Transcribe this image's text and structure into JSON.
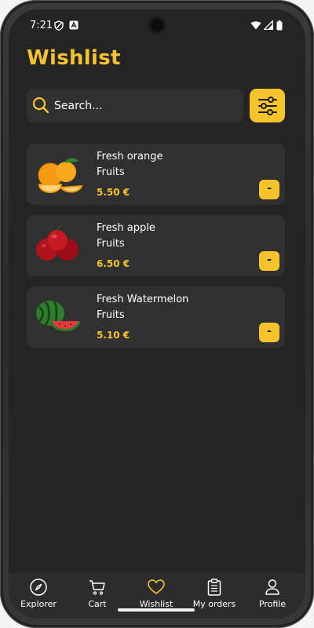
{
  "status_bar": {
    "time": "7:21"
  },
  "page": {
    "title": "Wishlist"
  },
  "search": {
    "placeholder": "Search..."
  },
  "wishlist": [
    {
      "name": "Fresh orange",
      "category": "Fruits",
      "price": "5.50 €",
      "remove_label": "-",
      "icon": "orange-icon"
    },
    {
      "name": "Fresh apple",
      "category": "Fruits",
      "price": "6.50 €",
      "remove_label": "-",
      "icon": "apple-icon"
    },
    {
      "name": "Fresh Watermelon",
      "category": "Fruits",
      "price": "5.10 €",
      "remove_label": "-",
      "icon": "watermelon-icon"
    }
  ],
  "bottom_nav": [
    {
      "label": "Explorer",
      "icon": "compass-icon"
    },
    {
      "label": "Cart",
      "icon": "cart-icon"
    },
    {
      "label": "Wishlist",
      "icon": "heart-icon",
      "active": true
    },
    {
      "label": "My orders",
      "icon": "clipboard-icon"
    },
    {
      "label": "Profile",
      "icon": "user-icon"
    }
  ],
  "colors": {
    "accent": "#f5c32c",
    "background": "#242424",
    "card": "#303030",
    "nav": "#2c2c2c"
  }
}
